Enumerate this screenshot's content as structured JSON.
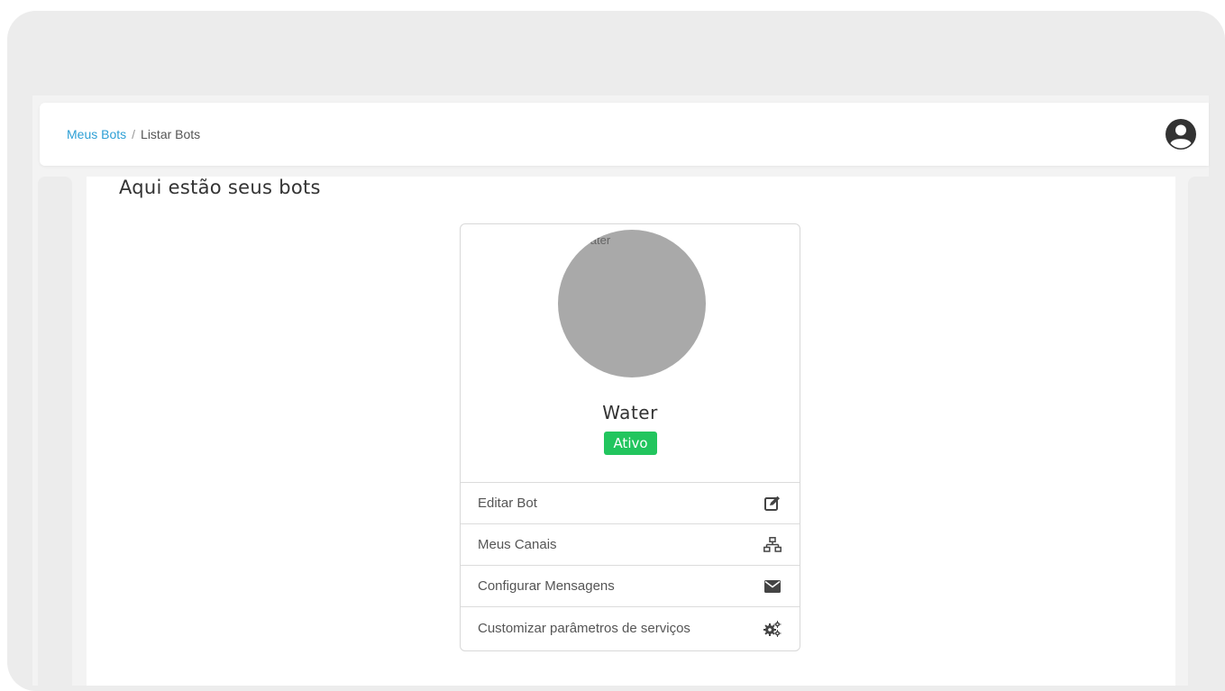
{
  "breadcrumb": {
    "link_label": "Meus Bots",
    "separator": "/",
    "current_label": "Listar Bots"
  },
  "page": {
    "title": "Aqui estão seus bots"
  },
  "bot_card": {
    "image_alt": "Water",
    "name": "Water",
    "status": "Ativo",
    "status_color": "#22c55e",
    "menu": [
      {
        "label": "Editar Bot",
        "icon": "edit-icon"
      },
      {
        "label": "Meus Canais",
        "icon": "sitemap-icon"
      },
      {
        "label": "Configurar Mensagens",
        "icon": "envelope-icon"
      },
      {
        "label": "Customizar parâmetros de serviços",
        "icon": "cogs-icon"
      }
    ]
  },
  "colors": {
    "link": "#2d9fd5",
    "badge": "#22c55e"
  }
}
